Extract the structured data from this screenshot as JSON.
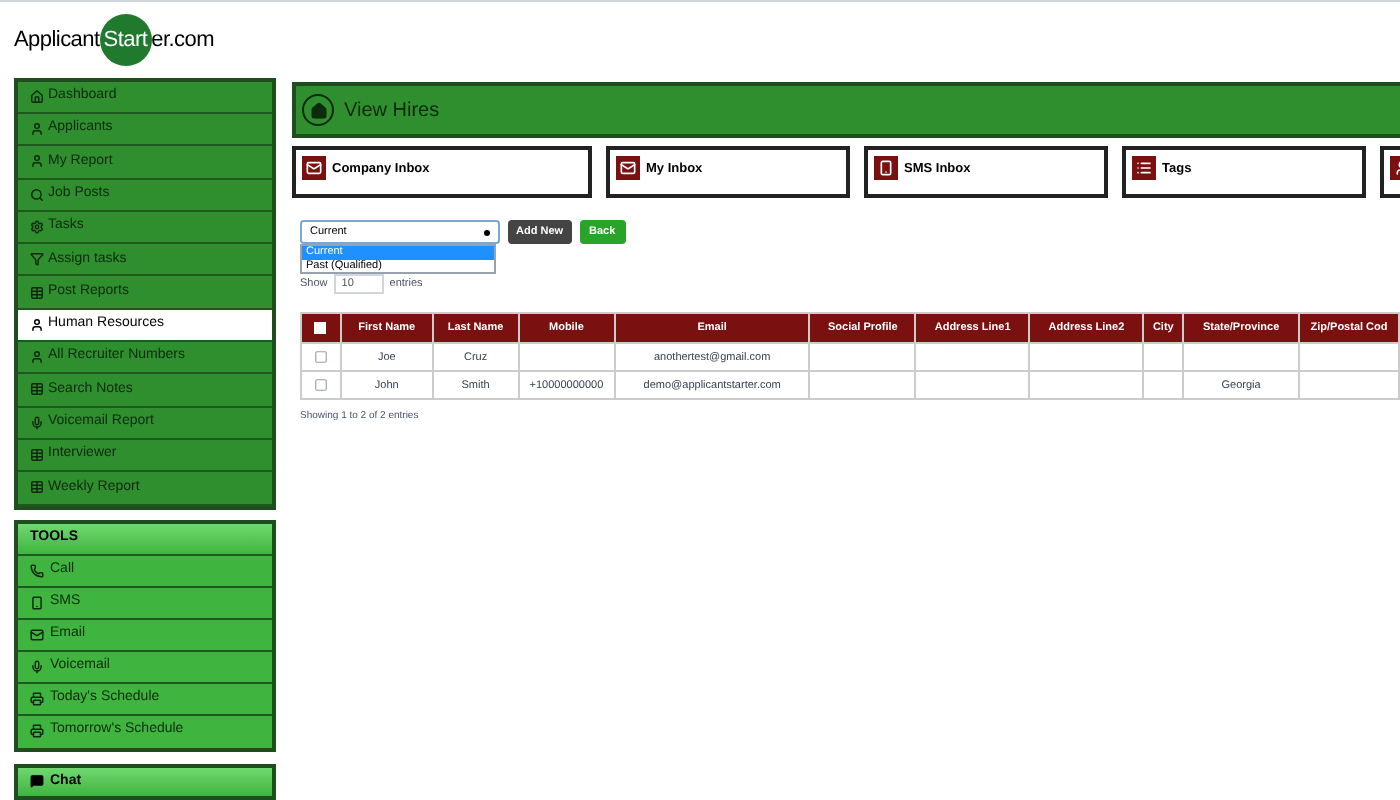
{
  "logo": {
    "before": "Applicant",
    "circle": "Start",
    "after": "er.com"
  },
  "sidebar": {
    "items": [
      {
        "label": "Dashboard",
        "selected": false
      },
      {
        "label": "Applicants",
        "selected": false
      },
      {
        "label": "My Report",
        "selected": false
      },
      {
        "label": "Job Posts",
        "selected": false
      },
      {
        "label": "Tasks",
        "selected": false
      },
      {
        "label": "Assign tasks",
        "selected": false
      },
      {
        "label": "Post Reports",
        "selected": false
      },
      {
        "label": "Human Resources",
        "selected": true
      },
      {
        "label": "All Recruiter Numbers",
        "selected": false
      },
      {
        "label": "Search Notes",
        "selected": false
      },
      {
        "label": "Voicemail Report",
        "selected": false
      },
      {
        "label": "Interviewer",
        "selected": false
      },
      {
        "label": "Weekly Report",
        "selected": false
      }
    ]
  },
  "tools": {
    "title": "TOOLS",
    "items": [
      {
        "label": "Call"
      },
      {
        "label": "SMS"
      },
      {
        "label": "Email"
      },
      {
        "label": "Voicemail"
      },
      {
        "label": "Today's Schedule"
      },
      {
        "label": "Tomorrow's Schedule"
      }
    ]
  },
  "chat": {
    "label": "Chat"
  },
  "header": {
    "title": "View Hires"
  },
  "cards": [
    {
      "label": "Company Inbox"
    },
    {
      "label": "My Inbox"
    },
    {
      "label": "SMS Inbox"
    },
    {
      "label": "Tags"
    }
  ],
  "filter": {
    "value": "Current",
    "options": [
      {
        "label": "Current",
        "selected": true
      },
      {
        "label": "Past (Qualified)",
        "selected": false
      }
    ]
  },
  "buttons": {
    "add": "Add New",
    "back": "Back"
  },
  "length": {
    "before": "Show",
    "value": "10",
    "after": "entries"
  },
  "table": {
    "select_all_checked": false,
    "columns": [
      "First Name",
      "Last Name",
      "Mobile",
      "Email",
      "Social Profile",
      "Address Line1",
      "Address Line2",
      "City",
      "State/Province",
      "Zip/Postal Cod"
    ],
    "rows": [
      {
        "checked": false,
        "cells": [
          "Joe",
          "Cruz",
          "",
          "anothertest@gmail.com",
          "",
          "",
          "",
          "",
          "",
          ""
        ]
      },
      {
        "checked": false,
        "cells": [
          "John",
          "Smith",
          "+10000000000",
          "demo@applicantstarter.com",
          "",
          "",
          "",
          "",
          "Georgia",
          ""
        ]
      }
    ]
  },
  "info": "Showing 1 to 2 of 2 entries"
}
